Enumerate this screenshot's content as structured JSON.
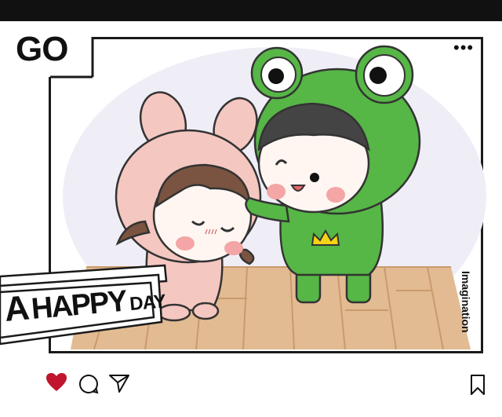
{
  "post": {
    "title": "GO",
    "menu_glyph": "•••",
    "side_label": "Imagination",
    "banner": {
      "word1": "A",
      "word2": "HAPPY",
      "word3": "DAY"
    }
  },
  "actions": {
    "like": {
      "icon": "heart-icon",
      "liked": true,
      "color": "#c0142f"
    },
    "comment": {
      "icon": "comment-icon"
    },
    "share": {
      "icon": "send-icon"
    },
    "save": {
      "icon": "bookmark-icon"
    }
  },
  "colors": {
    "frog_green": "#56b646",
    "bunny_pink": "#f4c7c0",
    "floor": "#ddb58c",
    "crown": "#f5d315"
  }
}
